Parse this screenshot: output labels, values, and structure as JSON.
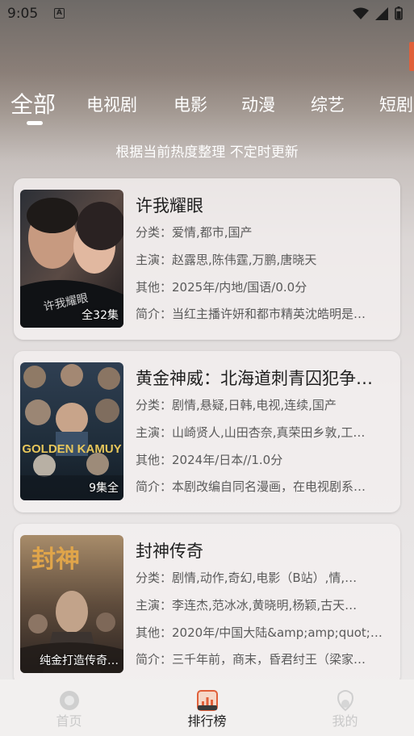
{
  "status_bar": {
    "time": "9:05"
  },
  "tabs": [
    {
      "label": "全部",
      "active": true
    },
    {
      "label": "电视剧",
      "active": false
    },
    {
      "label": "电影",
      "active": false
    },
    {
      "label": "动漫",
      "active": false
    },
    {
      "label": "综艺",
      "active": false
    },
    {
      "label": "短剧",
      "active": false
    }
  ],
  "subtitle": "根据当前热度整理 不定时更新",
  "labels": {
    "category": "分类：",
    "cast": "主演：",
    "other": "其他：",
    "intro": "简介："
  },
  "cards": [
    {
      "title": "许我耀眼",
      "category": "爱情,都市,国产",
      "cast": "赵露思,陈伟霆,万鹏,唐晓天",
      "other": "2025年/内地/国语/0.0分",
      "intro": "当红主播许妍和都市精英沈皓明是…",
      "badge": "全32集"
    },
    {
      "title": "黄金神威：北海道刺青囚犯争…",
      "category": "剧情,悬疑,日韩,电视,连续,国产",
      "cast": "山崎贤人,山田杏奈,真荣田乡敦,工…",
      "other": "2024年/日本//1.0分",
      "intro": "本剧改编自同名漫画，在电视剧系…",
      "badge": "9集全"
    },
    {
      "title": "封神传奇",
      "category": "剧情,动作,奇幻,电影（B站）,情,…",
      "cast": "李连杰,范冰冰,黄晓明,杨颖,古天…",
      "other": "2020年/中国大陆&amp;amp;quot;…",
      "intro": "三千年前，商末，昏君纣王（梁家…",
      "badge": "纯金打造传奇…"
    }
  ],
  "bottom_nav": [
    {
      "label": "首页",
      "icon": "home-icon",
      "active": false
    },
    {
      "label": "排行榜",
      "icon": "ranking-icon",
      "active": true
    },
    {
      "label": "我的",
      "icon": "profile-icon",
      "active": false
    }
  ],
  "colors": {
    "accent": "#e0603a",
    "nav_active": "#1e1e1e",
    "nav_inactive": "#c9c9c9"
  }
}
